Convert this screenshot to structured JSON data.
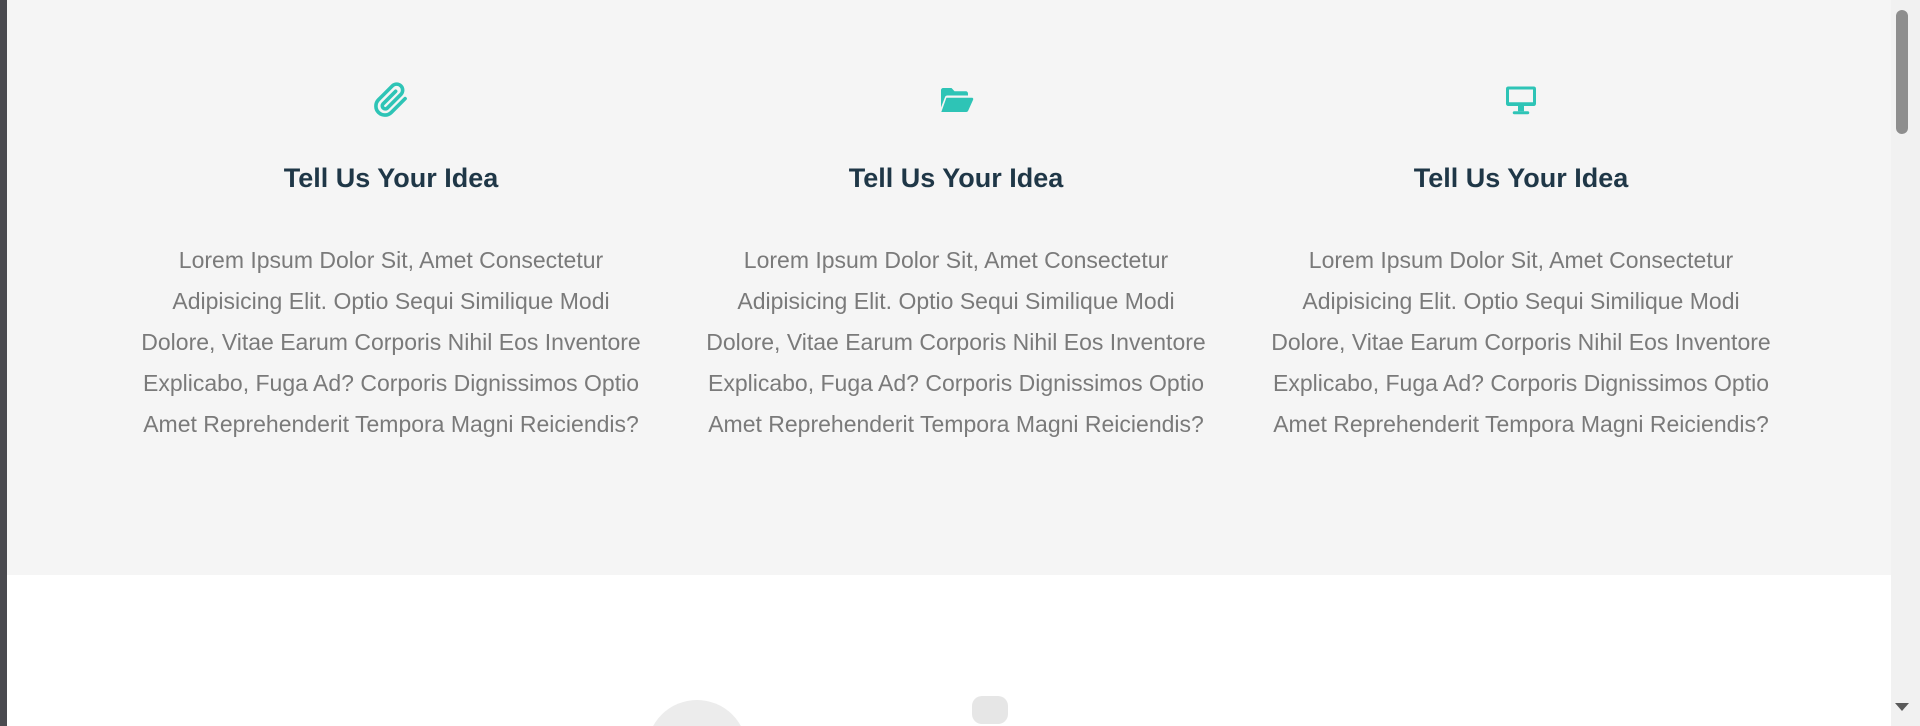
{
  "colors": {
    "accent": "#2ec4b6",
    "heading": "#1f3747",
    "body_text": "#7a7a7a",
    "section_bg": "#f5f5f5"
  },
  "features": [
    {
      "icon": "paperclip-icon",
      "title": "Tell Us Your Idea",
      "text": "Lorem Ipsum Dolor Sit, Amet Consectetur Adipisicing Elit. Optio Sequi Similique Modi Dolore, Vitae Earum Corporis Nihil Eos Inventore Explicabo, Fuga Ad? Corporis Dignissimos Optio Amet Reprehenderit Tempora Magni Reiciendis?"
    },
    {
      "icon": "folder-open-icon",
      "title": "Tell Us Your Idea",
      "text": "Lorem Ipsum Dolor Sit, Amet Consectetur Adipisicing Elit. Optio Sequi Similique Modi Dolore, Vitae Earum Corporis Nihil Eos Inventore Explicabo, Fuga Ad? Corporis Dignissimos Optio Amet Reprehenderit Tempora Magni Reiciendis?"
    },
    {
      "icon": "desktop-icon",
      "title": "Tell Us Your Idea",
      "text": "Lorem Ipsum Dolor Sit, Amet Consectetur Adipisicing Elit. Optio Sequi Similique Modi Dolore, Vitae Earum Corporis Nihil Eos Inventore Explicabo, Fuga Ad? Corporis Dignissimos Optio Amet Reprehenderit Tempora Magni Reiciendis?"
    }
  ]
}
